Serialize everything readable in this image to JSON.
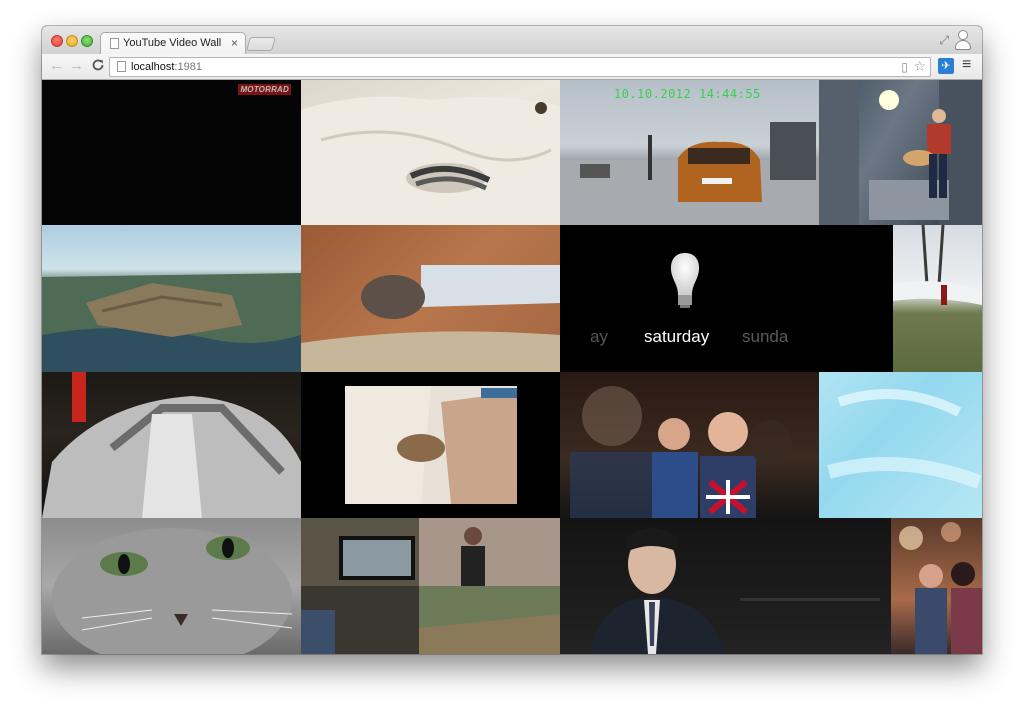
{
  "browser": {
    "tab_title": "YouTube Video Wall",
    "tab_close": "×",
    "url_host": "localhost",
    "url_port": ":1981"
  },
  "toolbar_icons": {
    "back": "←",
    "forward": "→",
    "reload": "C",
    "menu": "≡",
    "star": "☆",
    "fullscreen": "⤢"
  },
  "videos": {
    "motorrad_watermark": "MOTORRAD",
    "dashcam_timestamp": "10.10.2012 14:44:55",
    "hue_days": {
      "prev": "ay",
      "current": "saturday",
      "next": "sunda"
    }
  },
  "colors": {
    "wall_background": "#000000",
    "timestamp": "#35d24a",
    "extension_icon": "#2d7fd3"
  }
}
